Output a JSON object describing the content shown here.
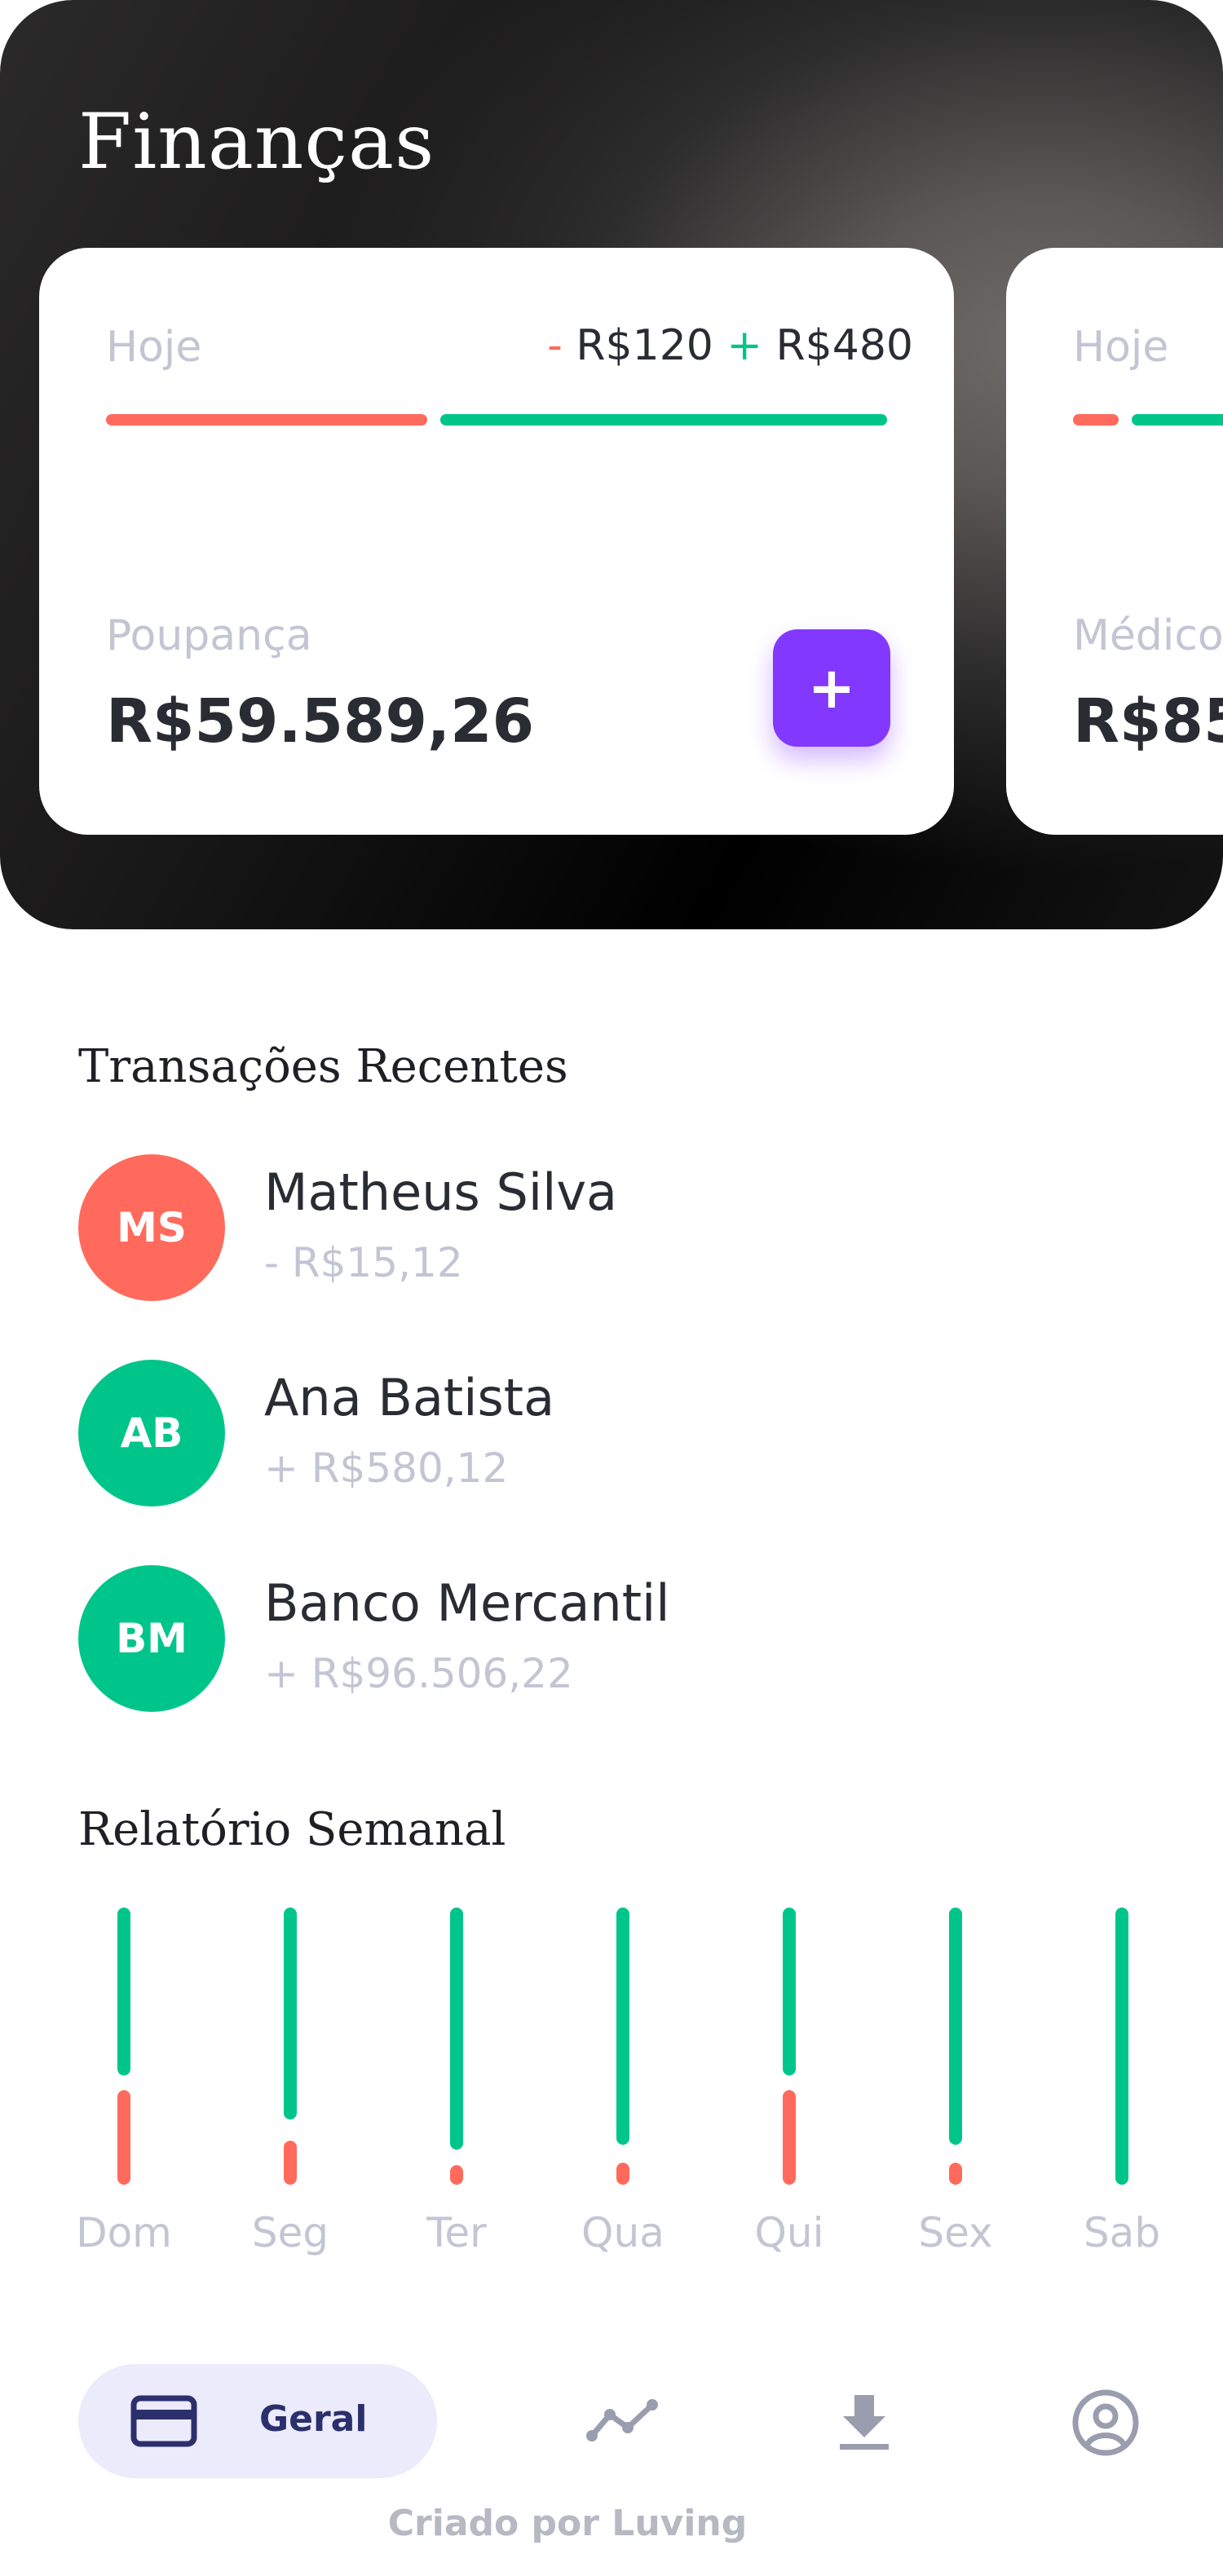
{
  "header": {
    "title": "Finanças"
  },
  "cards": [
    {
      "period": "Hoje",
      "expense": "R$120",
      "income": "R$480",
      "label": "Poupança",
      "value": "R$59.589,26",
      "add_label": "+"
    },
    {
      "period": "Hoje",
      "label": "Médico",
      "value": "R$85"
    }
  ],
  "signs": {
    "minus": "-",
    "plus": "+"
  },
  "transactions": {
    "title": "Transações Recentes",
    "items": [
      {
        "initials": "MS",
        "name": "Matheus Silva",
        "amount": "- R$15,12",
        "color": "#ff6a5c"
      },
      {
        "initials": "AB",
        "name": "Ana Batista",
        "amount": "+ R$580,12",
        "color": "#00c58a"
      },
      {
        "initials": "BM",
        "name": "Banco Mercantil",
        "amount": "+ R$96.506,22",
        "color": "#00c58a"
      }
    ]
  },
  "weekly_report": {
    "title": "Relatório Semanal",
    "colors": {
      "income": "#00c58a",
      "expense": "#ff6a5c"
    }
  },
  "chart_data": {
    "type": "bar",
    "categories": [
      "Dom",
      "Seg",
      "Ter",
      "Qua",
      "Qui",
      "Sex",
      "Sab"
    ],
    "series": [
      {
        "values": [
          0.64,
          0.8,
          0.91,
          0.89,
          0.64,
          0.89,
          1.0
        ]
      },
      {
        "values": [
          0.34,
          0.16,
          0.07,
          0.08,
          0.34,
          0.08,
          0.0
        ]
      }
    ],
    "stacked": true
  },
  "nav": {
    "active_label": "Geral",
    "icons": [
      "card-icon",
      "trend-icon",
      "download-icon",
      "profile-icon"
    ]
  },
  "footer": {
    "credit": "Criado por Luving"
  }
}
